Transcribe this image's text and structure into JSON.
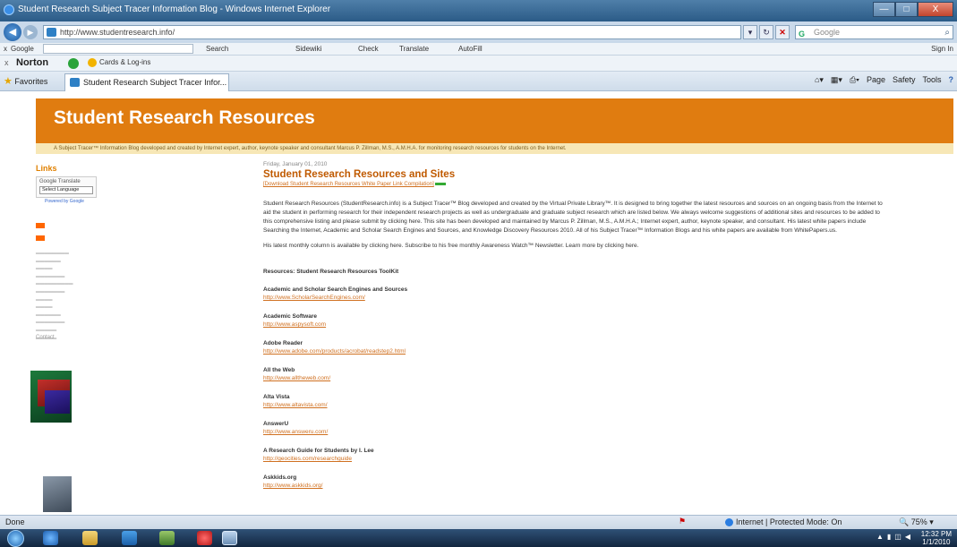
{
  "window": {
    "title": "Student Research Subject Tracer Information Blog - Windows Internet Explorer",
    "minimize": "—",
    "maximize": "□",
    "close": "X"
  },
  "address_bar": {
    "url": "http://www.studentresearch.info/",
    "search_placeholder": "Google"
  },
  "google_toolbar": {
    "close": "x",
    "label": "Google",
    "search": "Search",
    "sidewiki": "Sidewiki",
    "check": "Check",
    "translate": "Translate",
    "autofill": "AutoFill",
    "signin": "Sign In"
  },
  "norton_toolbar": {
    "close": "x",
    "brand": "Norton",
    "cards": "Cards & Log-ins"
  },
  "favorites_bar": {
    "favorites": "Favorites",
    "tab_title": "Student Research Subject Tracer Infor...",
    "commands": [
      "Page",
      "Safety",
      "Tools"
    ]
  },
  "page": {
    "site_title": "Student Research Resources",
    "tagline": "A Subject Tracer™ Information Blog developed and created by Internet expert, author, keynote speaker and consultant Marcus P. Zillman, M.S., A.M.H.A. for monitoring research resources for students on the Internet.",
    "sidebar": {
      "heading": "Links",
      "translate_label": "Google Translate",
      "select_language": "Select Language",
      "powered_by": "Powered by Google",
      "contact": "Contact"
    },
    "post": {
      "date": "Friday, January 01, 2010",
      "title": "Student Research Resources and Sites",
      "download": "[Download Student Research Resources White Paper Link Compilation]",
      "intro": "Student Research Resources (StudentResearch.info) is a Subject Tracer™ Blog developed and created by the Virtual Private Library™. It is designed to bring together the latest resources and sources on an ongoing basis from the Internet to aid the student in performing research for their independent research projects as well as undergraduate and graduate subject research which are listed below. We always welcome suggestions of additional sites and resources to be added to this comprehensive listing and please submit by clicking here. This site has been developed and maintained by Marcus P. Zillman, M.S., A.M.H.A.; Internet expert, author, keynote speaker, and consultant. His latest white papers include Searching the Internet, Academic and Scholar Search Engines and Sources, and Knowledge Discovery Resources 2010. All of his Subject Tracer™ Information Blogs and his white papers are available from WhitePapers.us.",
      "monthly": "His latest monthly column is available by clicking here. Subscribe to his free monthly Awareness Watch™ Newsletter. Learn more by clicking here.",
      "toolkit_heading": "Resources: Student Research Resources ToolKit",
      "resources": [
        {
          "name": "Academic and Scholar Search Engines and Sources",
          "url": "http://www.ScholarSearchEngines.com/"
        },
        {
          "name": "Academic Software",
          "url": "http://www.aspysoft.com"
        },
        {
          "name": "Adobe Reader",
          "url": "http://www.adobe.com/products/acrobat/readstep2.html"
        },
        {
          "name": "All the Web",
          "url": "http://www.alltheweb.com/"
        },
        {
          "name": "Alta Vista",
          "url": "http://www.altavista.com/"
        },
        {
          "name": "AnswerU",
          "url": "http://www.answeru.com/"
        },
        {
          "name": "A Research Guide for Students by I. Lee",
          "url": "http://geocities.com/researchguide"
        },
        {
          "name": "Askkids.org",
          "url": "http://www.askkids.org/"
        }
      ]
    }
  },
  "status_bar": {
    "status": "Done",
    "zone": "Internet | Protected Mode: On",
    "zoom": "75%"
  },
  "taskbar": {
    "time": "12:32 PM",
    "date": "1/1/2010"
  },
  "colors": {
    "banner": "#e07c10",
    "link": "#d07020",
    "title_bar": "#2b5b87"
  }
}
